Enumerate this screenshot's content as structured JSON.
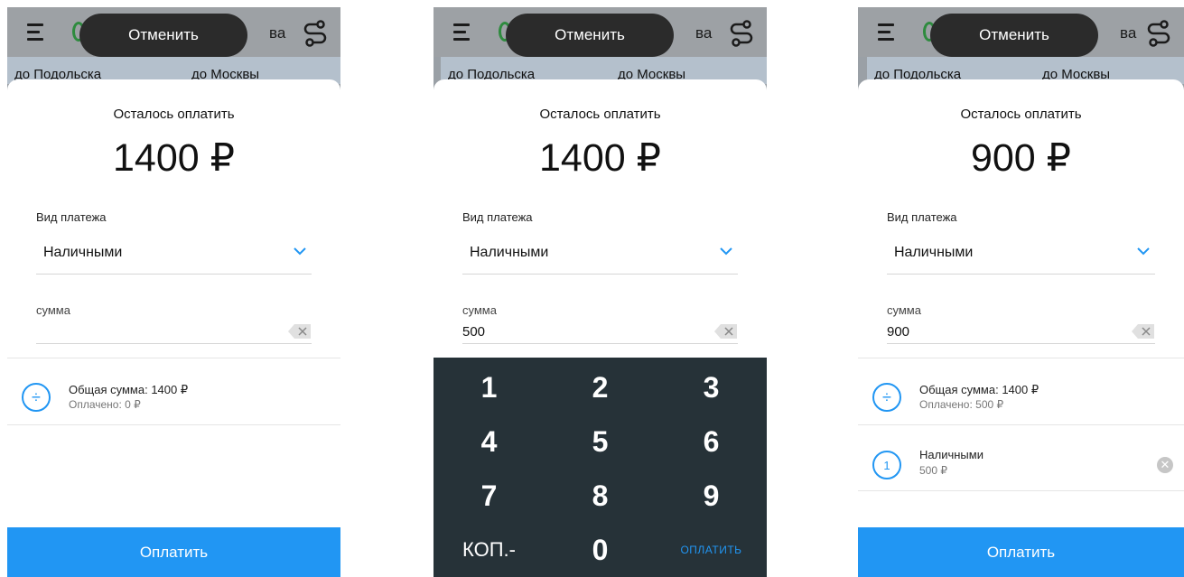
{
  "screens": [
    {
      "header": {
        "title_visible": "ва",
        "cancel_label": "Отменить"
      },
      "tabs": [
        "до Подольска",
        "до Москвы"
      ],
      "remain_label": "Осталось оплатить",
      "remain_amount": "1400 ₽",
      "pay_type_label": "Вид платежа",
      "pay_type_value": "Наличными",
      "sum_label": "сумма",
      "sum_value": "",
      "total_label": "Общая сумма: 1400 ₽",
      "paid_label": "Оплачено: 0 ₽",
      "pay_button": "Оплатить"
    },
    {
      "header": {
        "title_visible": "ва",
        "cancel_label": "Отменить"
      },
      "tabs": [
        "до Подольска",
        "до Москвы"
      ],
      "remain_label": "Осталось оплатить",
      "remain_amount": "1400 ₽",
      "pay_type_label": "Вид платежа",
      "pay_type_value": "Наличными",
      "sum_label": "сумма",
      "sum_value": "500",
      "keypad": {
        "keys": [
          "1",
          "2",
          "3",
          "4",
          "5",
          "6",
          "7",
          "8",
          "9",
          "КОП.-",
          "0",
          "ОПЛАТИТЬ"
        ]
      }
    },
    {
      "header": {
        "title_visible": "ва",
        "cancel_label": "Отменить"
      },
      "tabs": [
        "до Подольска",
        "до Москвы"
      ],
      "remain_label": "Осталось оплатить",
      "remain_amount": "900 ₽",
      "pay_type_label": "Вид платежа",
      "pay_type_value": "Наличными",
      "sum_label": "сумма",
      "sum_value": "900",
      "total_label": "Общая сумма: 1400 ₽",
      "paid_label": "Оплачено: 500 ₽",
      "payment_item": {
        "index": "1",
        "method": "Наличными",
        "amount": "500 ₽"
      },
      "pay_button": "Оплатить"
    }
  ],
  "colors": {
    "accent": "#2196f3",
    "keypad_bg": "#263238",
    "pill_bg": "#2b2b2b",
    "tab_bg": "#b4c0cc"
  }
}
